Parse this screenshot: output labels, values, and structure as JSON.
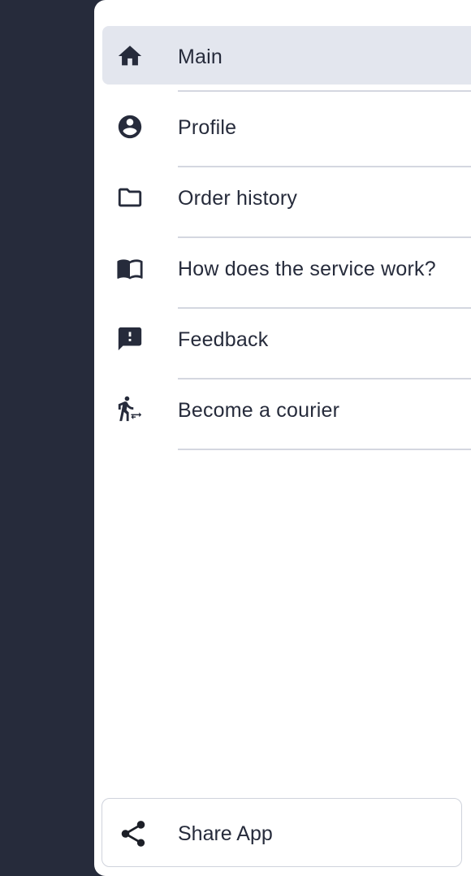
{
  "menu": {
    "items": [
      {
        "label": "Main",
        "icon": "home-icon",
        "active": true
      },
      {
        "label": "Profile",
        "icon": "account-circle-icon",
        "active": false
      },
      {
        "label": "Order history",
        "icon": "folder-icon",
        "active": false
      },
      {
        "label": "How does the service work?",
        "icon": "book-icon",
        "active": false
      },
      {
        "label": "Feedback",
        "icon": "feedback-icon",
        "active": false
      },
      {
        "label": "Become a courier",
        "icon": "courier-icon",
        "active": false
      }
    ]
  },
  "share": {
    "label": "Share App",
    "icon": "share-icon"
  },
  "colors": {
    "background": "#262b3b",
    "drawer": "#ffffff",
    "active_item": "#e3e6ee",
    "text": "#262b3b",
    "divider": "#d4d7e0"
  }
}
